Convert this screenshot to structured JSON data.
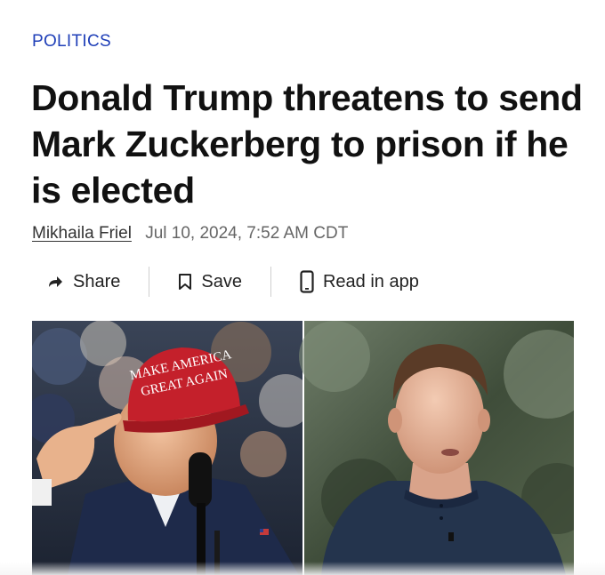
{
  "article": {
    "category": "POLITICS",
    "headline": "Donald Trump threatens to send Mark Zuckerberg to prison if he is elected",
    "author": "Mikhaila Friel",
    "date": "Jul 10, 2024, 7:52 AM CDT"
  },
  "actions": {
    "share_label": "Share",
    "save_label": "Save",
    "read_in_app_label": "Read in app"
  },
  "photo": {
    "hat_line1": "MAKE AMERICA",
    "hat_line2": "GREAT AGAIN",
    "hat_color": "#c4202b"
  },
  "colors": {
    "category": "#1f3fb8",
    "text": "#111111"
  }
}
